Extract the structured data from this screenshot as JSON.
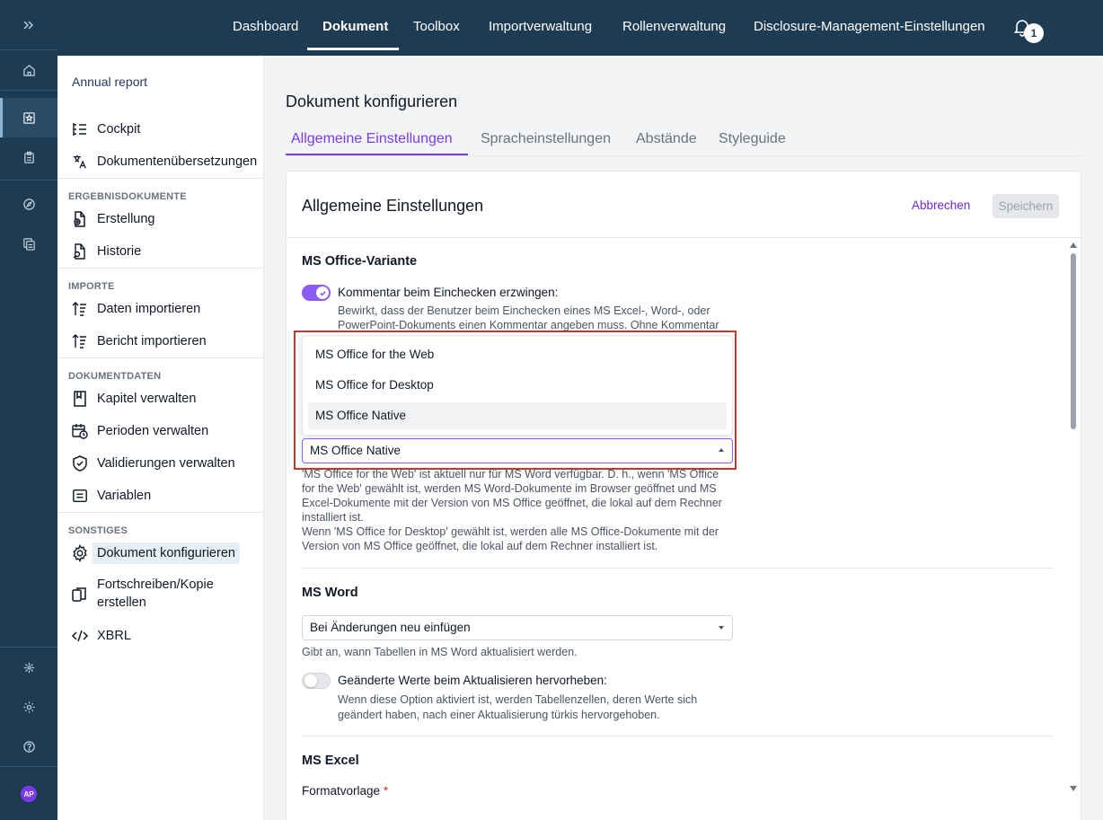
{
  "topnav": {
    "items": [
      "Dashboard",
      "Dokument",
      "Toolbox",
      "Importverwaltung",
      "Rollenverwaltung",
      "Disclosure-Management-Einstellungen"
    ],
    "notification_count": "1"
  },
  "rail": {
    "avatar_initials": "AP"
  },
  "sidebar": {
    "title": "Annual report",
    "items": {
      "cockpit": "Cockpit",
      "uebersetzungen": "Dokumentenübersetzungen",
      "erstellung": "Erstellung",
      "historie": "Historie",
      "daten_importieren": "Daten importieren",
      "bericht_importieren": "Bericht importieren",
      "kapitel": "Kapitel verwalten",
      "perioden": "Perioden verwalten",
      "validierungen": "Validierungen verwalten",
      "variablen": "Variablen",
      "konfigurieren": "Dokument konfigurieren",
      "fortschreiben_1": "Fortschreiben/Kopie",
      "fortschreiben_2": "erstellen",
      "xbrl": "XBRL"
    },
    "headers": {
      "ergebnis": "ERGEBNISDOKUMENTE",
      "importe": "IMPORTE",
      "dokumentdaten": "DOKUMENTDATEN",
      "sonstiges": "SONSTIGES"
    }
  },
  "main": {
    "page_title": "Dokument konfigurieren",
    "tabs": [
      "Allgemeine Einstellungen",
      "Spracheinstellungen",
      "Abstände",
      "Styleguide"
    ]
  },
  "card": {
    "title": "Allgemeine Einstellungen",
    "cancel_label": "Abbrechen",
    "save_label": "Speichern",
    "office": {
      "title": "MS Office-Variante",
      "toggle_label": "Kommentar beim Einchecken erzwingen:",
      "toggle_desc_1": "Bewirkt, dass der Benutzer beim Einchecken eines MS Excel-, Word-, oder",
      "toggle_desc_2": "PowerPoint-Dokuments einen Kommentar angeben muss. Ohne Kommentar",
      "options": [
        "MS Office for the Web",
        "MS Office for Desktop",
        "MS Office Native"
      ],
      "selected": "MS Office Native",
      "desc_lines": [
        "'MS Office for the Web' ist aktuell nur für MS Word verfügbar. D. h., wenn 'MS Office",
        "for the Web' gewählt ist, werden MS Word-Dokumente im Browser geöffnet und MS",
        "Excel-Dokumente mit der Version von MS Office geöffnet, die lokal auf dem Rechner",
        "installiert ist.",
        "Wenn 'MS Office for Desktop' gewählt ist, werden alle MS Office-Dokumente mit der",
        "Version von MS Office geöffnet, die lokal auf dem Rechner installiert ist."
      ]
    },
    "word": {
      "title": "MS Word",
      "select_value": "Bei Änderungen neu einfügen",
      "select_desc": "Gibt an, wann Tabellen in MS Word aktualisiert werden.",
      "toggle_label": "Geänderte Werte beim Aktualisieren hervorheben:",
      "toggle_desc_1": "Wenn diese Option aktiviert ist, werden Tabellenzellen, deren Werte sich",
      "toggle_desc_2": "geändert haben, nach einer Aktualisierung türkis hervorgehoben."
    },
    "excel": {
      "title": "MS Excel",
      "format_label": "Formatvorlage",
      "required_mark": "*"
    }
  },
  "colors": {
    "rail": "#1d3b52",
    "accent": "#7c3aed",
    "highlight": "#c0392b"
  }
}
